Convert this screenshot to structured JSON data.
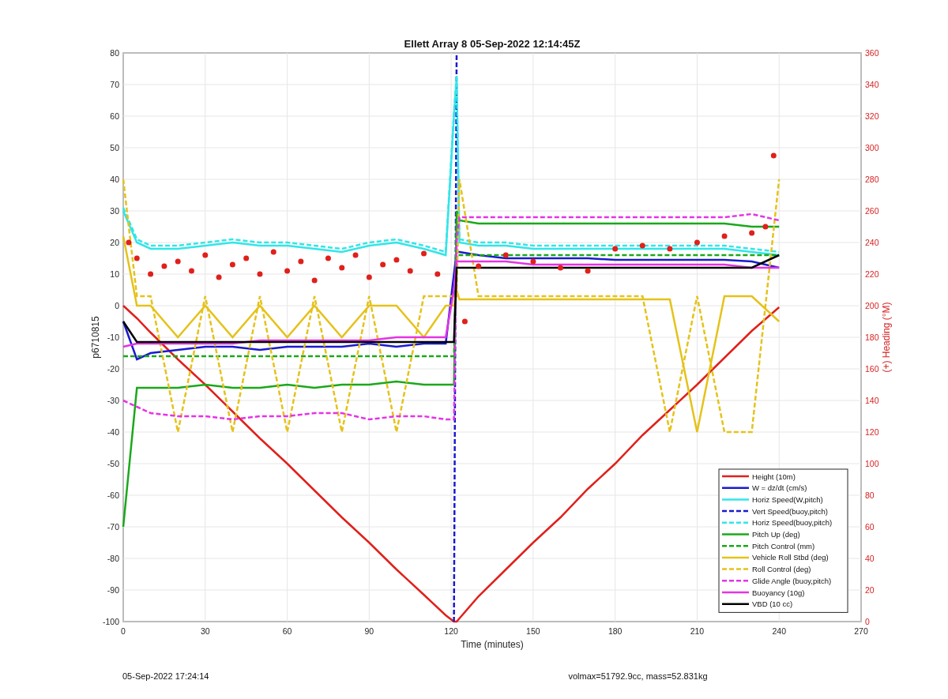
{
  "figure": {
    "plot": {
      "chart_data": {
        "type": "line",
        "title": "Ellett Array 8 05-Sep-2022 12:14:45Z",
        "xlabel": "Time (minutes)",
        "ylabel": "p6710815",
        "xlim": [
          0,
          270
        ],
        "ylim": [
          -100,
          80
        ],
        "xticks": [
          0,
          30,
          60,
          90,
          120,
          150,
          180,
          210,
          240,
          270
        ],
        "yticks": [
          -100,
          -90,
          -80,
          -70,
          -60,
          -50,
          -40,
          -30,
          -20,
          -10,
          0,
          10,
          20,
          30,
          40,
          50,
          60,
          70,
          80
        ],
        "grid": true,
        "legend": true,
        "x": [
          0,
          5,
          10,
          20,
          30,
          40,
          50,
          60,
          70,
          80,
          90,
          100,
          110,
          118,
          121,
          122,
          123,
          130,
          140,
          150,
          160,
          170,
          180,
          190,
          200,
          210,
          220,
          230,
          240
        ],
        "series": [
          {
            "name": "Height (10m)",
            "color": "#e0201b",
            "line_style": "solid",
            "values": [
              0,
              -4,
              -8.5,
              -17,
              -25,
              -33.5,
              -42,
              -50,
              -58.5,
              -67,
              -75,
              -83.5,
              -91.5,
              -98,
              -100,
              -100,
              -99,
              -92,
              -83.5,
              -75,
              -67,
              -58,
              -50,
              -41,
              -33,
              -25,
              -16.5,
              -8,
              -0.5
            ]
          },
          {
            "name": "W = dz/dt (cm/s)",
            "color": "#1a1ad0",
            "line_style": "solid",
            "values": [
              -5,
              -17,
              -15,
              -14,
              -13,
              -13,
              -14,
              -13,
              -13,
              -13,
              -12,
              -13,
              -12,
              -12,
              10,
              17,
              17,
              16,
              15,
              15,
              15,
              15,
              14.5,
              14.5,
              14.5,
              14.5,
              14.5,
              14,
              12
            ]
          },
          {
            "name": "Horiz Speed(W,pitch)",
            "color": "#33e5e8",
            "line_style": "solid",
            "values": [
              30,
              20,
              18,
              18,
              19,
              20,
              19,
              19,
              18,
              17,
              19,
              20,
              18,
              16,
              60,
              72,
              20,
              19,
              19,
              18,
              18,
              18,
              18,
              18,
              18,
              18,
              18,
              17,
              16
            ]
          },
          {
            "name": "Vert Speed(buoy,pitch)",
            "color": "#1a1ad0",
            "line_style": "dashed",
            "values": [
              null,
              null,
              null,
              null,
              null,
              null,
              null,
              null,
              null,
              null,
              null,
              null,
              null,
              null,
              -100,
              80,
              null,
              null,
              null,
              null,
              null,
              null,
              null,
              null,
              null,
              null,
              null,
              null,
              null
            ]
          },
          {
            "name": "Horiz Speed(buoy,pitch)",
            "color": "#33e5e8",
            "line_style": "dashed",
            "values": [
              31,
              21,
              19,
              19,
              20,
              21,
              20,
              20,
              19,
              18,
              20,
              21,
              19,
              17,
              61,
              73,
              21,
              20,
              20,
              19,
              19,
              19,
              19,
              19,
              19,
              19,
              19,
              18,
              17
            ]
          },
          {
            "name": "Pitch Up (deg)",
            "color": "#1aa81a",
            "line_style": "solid",
            "values": [
              -70,
              -26,
              -26,
              -26,
              -25,
              -26,
              -26,
              -25,
              -26,
              -25,
              -25,
              -24,
              -25,
              -25,
              -25,
              30,
              27,
              26,
              26,
              26,
              26,
              26,
              26,
              26,
              26,
              26,
              26,
              25,
              25
            ]
          },
          {
            "name": "Pitch Control (mm)",
            "color": "#1aa81a",
            "line_style": "dashed",
            "values": [
              -16,
              -16,
              -16,
              -16,
              -16,
              -16,
              -16,
              -16,
              -16,
              -16,
              -16,
              -16,
              -16,
              -16,
              -16,
              16,
              16,
              16,
              16,
              16,
              16,
              16,
              16,
              16,
              16,
              16,
              16,
              16,
              16
            ]
          },
          {
            "name": "Vehicle Roll Stbd (deg)",
            "color": "#e5c21a",
            "line_style": "solid",
            "values": [
              22,
              0,
              0,
              -10,
              0,
              -10,
              0,
              -10,
              0,
              -10,
              0,
              0,
              -10,
              0,
              0,
              5,
              2,
              2,
              2,
              2,
              2,
              2,
              2,
              2,
              2,
              -40,
              3,
              3,
              -5
            ]
          },
          {
            "name": "Roll Control (deg)",
            "color": "#e5c21a",
            "line_style": "dashed",
            "values": [
              40,
              3,
              3,
              -40,
              3,
              -40,
              3,
              -40,
              3,
              -40,
              3,
              -40,
              3,
              3,
              3,
              3,
              40,
              3,
              3,
              3,
              3,
              3,
              3,
              3,
              -40,
              3,
              -40,
              -40,
              40
            ]
          },
          {
            "name": "Glide Angle (buoy,pitch)",
            "color": "#e533e5",
            "line_style": "dashed",
            "values": [
              -30,
              -32,
              -34,
              -35,
              -35,
              -36,
              -35,
              -35,
              -34,
              -34,
              -36,
              -35,
              -35,
              -36,
              -36,
              20,
              28,
              28,
              28,
              28,
              28,
              28,
              28,
              28,
              28,
              28,
              28,
              29,
              27
            ]
          },
          {
            "name": "Buoyancy (10g)",
            "color": "#e533e5",
            "line_style": "solid",
            "values": [
              -13,
              -12,
              -12,
              -12,
              -12,
              -12,
              -11,
              -11,
              -11,
              -11,
              -11,
              -10,
              -10,
              -10,
              5,
              14,
              14,
              14,
              14,
              13,
              13,
              13,
              13,
              13,
              13,
              13,
              13,
              12,
              12
            ]
          },
          {
            "name": "VBD (10 cc)",
            "color": "#000000",
            "line_style": "solid",
            "values": [
              -5,
              -11.5,
              -11.5,
              -11.5,
              -11.5,
              -11.5,
              -11.5,
              -11.5,
              -11.5,
              -11.5,
              -11.5,
              -11.5,
              -11.5,
              -11.5,
              -11.5,
              12,
              12,
              12,
              12,
              12,
              12,
              12,
              12,
              12,
              12,
              12,
              12,
              12,
              16
            ]
          }
        ]
      }
    },
    "heading_axis": {
      "chart_data": {
        "type": "scatter",
        "ylabel": "(+) Heading (°M)",
        "xlim": [
          0,
          270
        ],
        "ylim": [
          0,
          360
        ],
        "yticks": [
          0,
          20,
          40,
          60,
          80,
          100,
          120,
          140,
          160,
          180,
          200,
          220,
          240,
          260,
          280,
          300,
          320,
          340,
          360
        ],
        "x": [
          2,
          5,
          10,
          15,
          20,
          25,
          30,
          35,
          40,
          45,
          50,
          55,
          60,
          65,
          70,
          75,
          80,
          85,
          90,
          95,
          100,
          105,
          110,
          115,
          125,
          130,
          140,
          150,
          160,
          170,
          180,
          190,
          200,
          210,
          220,
          230,
          235,
          238
        ],
        "series": [
          {
            "color": "#e0201b",
            "values": [
              240,
              230,
              220,
              225,
              228,
              222,
              232,
              218,
              226,
              230,
              220,
              234,
              222,
              228,
              216,
              230,
              224,
              232,
              218,
              226,
              229,
              222,
              233,
              220,
              190,
              225,
              232,
              228,
              224,
              222,
              236,
              238,
              236,
              240,
              244,
              246,
              250,
              295
            ]
          }
        ]
      }
    },
    "footer": {
      "printed_at": "05-Sep-2022 17:24:14",
      "info": "volmax=51792.9cc, mass=52.831kg"
    }
  }
}
